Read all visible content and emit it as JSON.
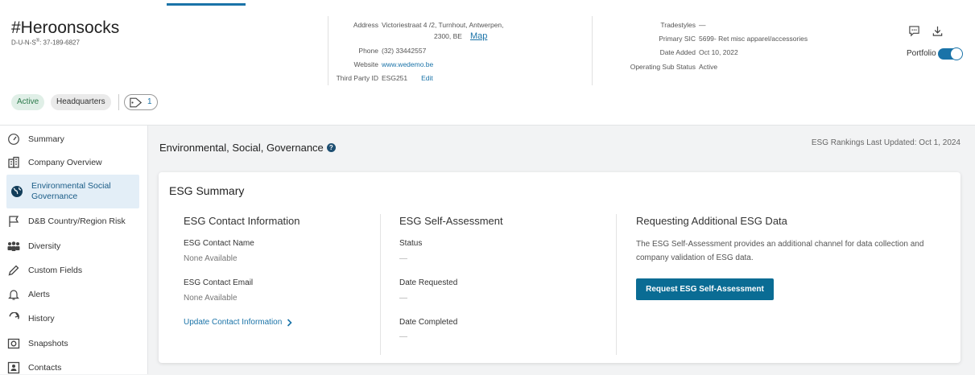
{
  "company": {
    "name": "#Heroonsocks",
    "duns_label": "D-U-N-S",
    "duns_sup": "®",
    "duns_value": ": 37-189-6827"
  },
  "address_block": {
    "address_label": "Address",
    "address_line1": "Victoriestraat 4 /2, Turnhout, Antwerpen,",
    "address_line2": "2300, BE",
    "map_link": "Map",
    "phone_label": "Phone",
    "phone_value": "(32) 33442557",
    "website_label": "Website",
    "website_value": "www.wedemo.be",
    "third_party_label": "Third Party ID",
    "third_party_value": "ESG251",
    "edit_link": "Edit"
  },
  "trade_block": {
    "tradestyles_label": "Tradestyles",
    "tradestyles_value": "—",
    "sic_label": "Primary SIC",
    "sic_value": "5699- Ret misc apparel/accessories",
    "date_added_label": "Date Added",
    "date_added_value": "Oct 10, 2022",
    "op_status_label": "Operating Sub Status",
    "op_status_value": "Active"
  },
  "header_actions": {
    "portfolio_label": "Portfolio",
    "comment_icon": "comment-icon",
    "download_icon": "download-icon"
  },
  "chips": {
    "active": "Active",
    "headquarters": "Headquarters",
    "tag_count": "1"
  },
  "sidebar": {
    "items": [
      {
        "label": "Summary",
        "icon": "gauge-icon"
      },
      {
        "label": "Company Overview",
        "icon": "building-icon"
      },
      {
        "label": "Environmental Social",
        "label2": "Governance",
        "icon": "globe-icon",
        "active": true
      },
      {
        "label": "D&B Country/Region Risk",
        "icon": "flag-icon"
      },
      {
        "label": "Diversity",
        "icon": "people-icon"
      },
      {
        "label": "Custom Fields",
        "icon": "pencil-icon"
      },
      {
        "label": "Alerts",
        "icon": "bell-icon"
      },
      {
        "label": "History",
        "icon": "refresh-icon"
      },
      {
        "label": "Snapshots",
        "icon": "camera-icon"
      },
      {
        "label": "Contacts",
        "icon": "contacts-icon"
      }
    ]
  },
  "main": {
    "title": "Environmental, Social, Governance",
    "last_updated": "ESG Rankings Last Updated: Oct 1, 2024"
  },
  "card": {
    "title": "ESG Summary",
    "contact": {
      "title": "ESG Contact Information",
      "name_label": "ESG Contact Name",
      "name_value": "None Available",
      "email_label": "ESG Contact Email",
      "email_value": "None Available",
      "update_link": "Update Contact Information"
    },
    "self_assessment": {
      "title": "ESG Self-Assessment",
      "status_label": "Status",
      "status_value": "—",
      "requested_label": "Date Requested",
      "requested_value": "—",
      "completed_label": "Date Completed",
      "completed_value": "—"
    },
    "request": {
      "title": "Requesting Additional ESG Data",
      "description": "The ESG Self-Assessment provides an additional channel for data collection and company validation of ESG data.",
      "button": "Request ESG Self-Assessment"
    }
  },
  "colors": {
    "accent": "#1a73a8",
    "button": "#0a6c94",
    "active_chip_bg": "#e0efe7",
    "active_chip_text": "#2c7a4b",
    "sidebar_active_bg": "#e3eef7"
  }
}
